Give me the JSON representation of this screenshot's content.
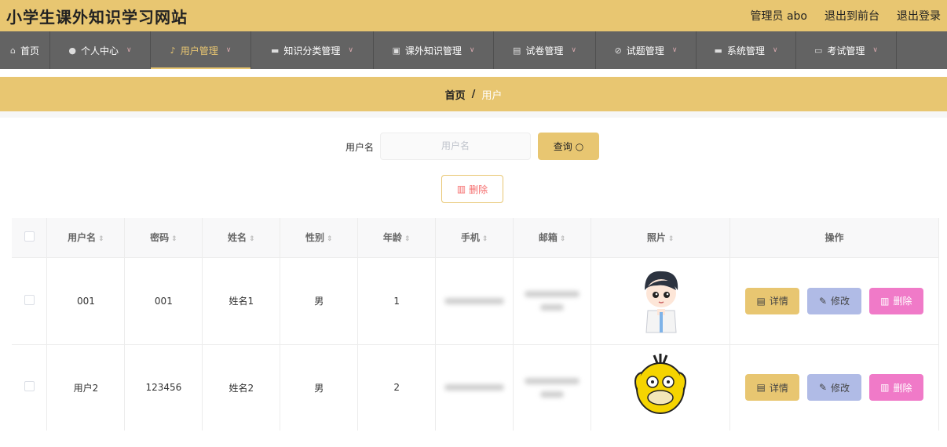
{
  "header": {
    "title": "小学生课外知识学习网站",
    "admin": "管理员 abo",
    "to_front": "退出到前台",
    "logout": "退出登录"
  },
  "nav": {
    "items": [
      {
        "label": "首页",
        "icon": "home-icon"
      },
      {
        "label": "个人中心",
        "icon": "user-icon"
      },
      {
        "label": "用户管理",
        "icon": "mic-icon"
      },
      {
        "label": "知识分类管理",
        "icon": "chat-icon"
      },
      {
        "label": "课外知识管理",
        "icon": "clipboard-icon"
      },
      {
        "label": "试卷管理",
        "icon": "list-icon"
      },
      {
        "label": "试题管理",
        "icon": "bell-off-icon"
      },
      {
        "label": "系统管理",
        "icon": "briefcase-icon"
      },
      {
        "label": "考试管理",
        "icon": "message-icon"
      }
    ],
    "active_index": 2
  },
  "breadcrumb": {
    "home": "首页",
    "sep": "/",
    "current": "用户"
  },
  "search": {
    "label": "用户名",
    "placeholder": "用户名",
    "button": "查询"
  },
  "bulk_delete": "删除",
  "table": {
    "headers": [
      "用户名",
      "密码",
      "姓名",
      "性别",
      "年龄",
      "手机",
      "邮箱",
      "照片",
      "操作"
    ],
    "rows": [
      {
        "username": "001",
        "password": "001",
        "name": "姓名1",
        "gender": "男",
        "age": "1",
        "photo": "boy-cartoon-photo"
      },
      {
        "username": "用户2",
        "password": "123456",
        "name": "姓名2",
        "gender": "男",
        "age": "2",
        "photo": "yellow-duck-photo"
      }
    ],
    "actions": {
      "detail": "详情",
      "edit": "修改",
      "delete": "删除"
    }
  },
  "colors": {
    "accent": "#e8c671",
    "nav_bg": "#636363",
    "edit": "#b0bbe6",
    "delete": "#f07ac8"
  }
}
